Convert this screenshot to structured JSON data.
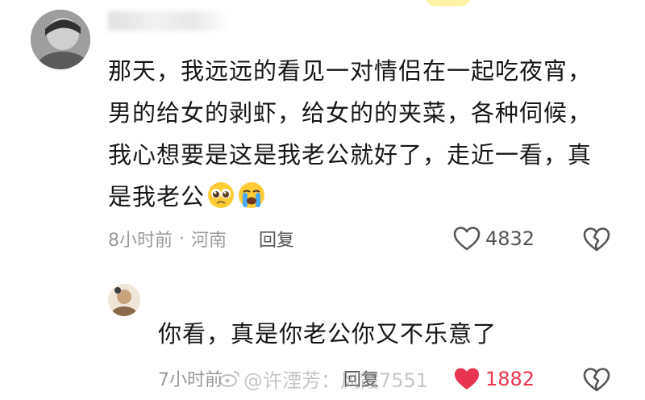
{
  "comment": {
    "username": "",
    "text": "那天，我远远的看见一对情侣在一起吃夜宵，男的给女的剥虾，给女的的夹菜，各种伺候，我心想要是这是我老公就好了，走近一看，真是我老公",
    "emojis": [
      "pleading-face-emoji",
      "loudly-crying-face-emoji"
    ],
    "time": "8小时前",
    "dot": "·",
    "location": "河南",
    "reply_label": "回复",
    "like_count": "4832",
    "liked": false,
    "icons": [
      "heart-outline-icon",
      "broken-heart-icon"
    ]
  },
  "reply": {
    "username": "",
    "text": "你看，真是你老公你又不乐意了",
    "time": "7小时前",
    "reply_label": "回复",
    "like_count": "1882",
    "liked": true,
    "like_color": "#e8344e",
    "icons": [
      "heart-filled-icon",
      "broken-heart-icon"
    ]
  },
  "watermark": {
    "text": "@许湮芳：风霞7551",
    "icon": "weibo-icon"
  },
  "colors": {
    "text": "#161616",
    "meta": "#9a9a9a",
    "accent": "#e8344e"
  }
}
